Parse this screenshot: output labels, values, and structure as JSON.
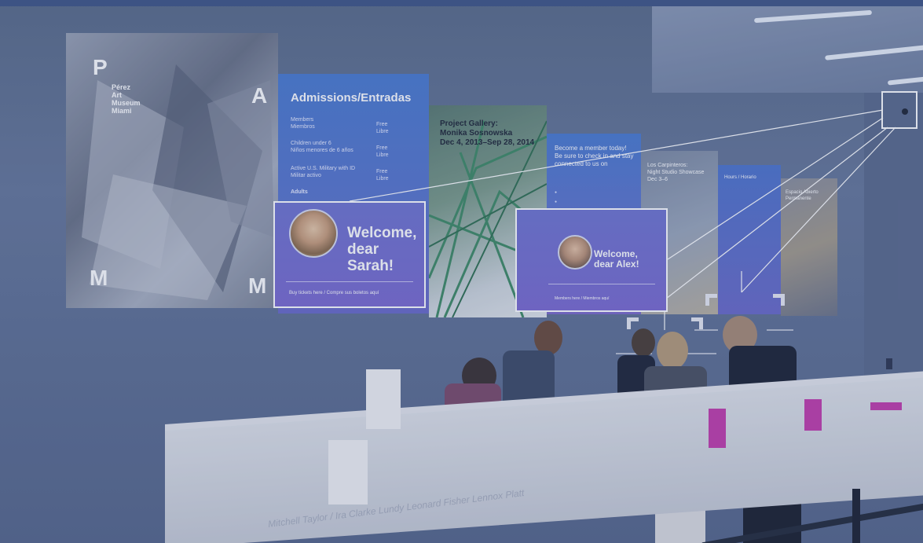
{
  "wall": {
    "logo": {
      "letter_top_left": "P",
      "letter_top_right": "A",
      "letter_bottom_left": "M",
      "letter_bottom_right": "M",
      "name": "Pérez\nArt\nMuseum\nMiami"
    },
    "admissions": {
      "title": "Admissions/Entradas",
      "rows": [
        {
          "label": "Members\nMiembros",
          "price": "Free\nLibre"
        },
        {
          "label": "Children under 6\nNiños menores de 6 años",
          "price": "Free\nLibre"
        },
        {
          "label": "Active U.S. Military with ID\nMilitar activo",
          "price": "Free\nLibre"
        },
        {
          "label": "Adults",
          "price": ""
        }
      ]
    },
    "gallery": {
      "text": "Project Gallery:\nMonika Sosnowska\nDec 4, 2013–Sep 28, 2014"
    },
    "membership": {
      "text": "Become a member today!\nBe sure to check in and stay connected to us on"
    },
    "photo_panel_1": {
      "text": "Los Carpinteros:\nNight Studio Showcase\nDec 3–6"
    },
    "hours": {
      "text": "Hours / Horario"
    },
    "photo_panel_2": {
      "text": "Espacio Abierto\nPermanente"
    }
  },
  "welcome_cards": [
    {
      "greeting_line1": "Welcome,",
      "greeting_line2": "dear Sarah!",
      "footer": "Buy tickets here  /  Compre sus boletos aquí"
    },
    {
      "greeting_line1": "Welcome,",
      "greeting_line2": "dear Alex!",
      "footer": "Members here  /  Miembros aquí"
    }
  ],
  "desk": {
    "engraving": "Mitchell Taylor / Ira Clarke Lundy Leonard Fisher Lennox Platt"
  },
  "colors": {
    "tint": "#3c4f86",
    "panel_blue": "#4a7ad0",
    "panel_purple": "#7a6ad0",
    "highlight": "#ffffff",
    "pink_brochure": "#c23cab"
  }
}
